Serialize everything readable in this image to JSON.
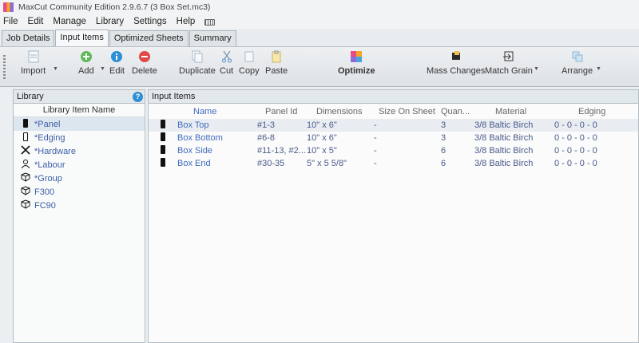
{
  "window": {
    "title": "MaxCut Community Edition 2.9.6.7 (3 Box Set.mc3)"
  },
  "menu": [
    "File",
    "Edit",
    "Manage",
    "Library",
    "Settings",
    "Help"
  ],
  "tabs": [
    {
      "label": "Job Details",
      "active": false
    },
    {
      "label": "Input Items",
      "active": true
    },
    {
      "label": "Optimized Sheets",
      "active": false
    },
    {
      "label": "Summary",
      "active": false
    }
  ],
  "toolbar": {
    "import": "Import",
    "add": "Add",
    "edit": "Edit",
    "delete": "Delete",
    "duplicate": "Duplicate",
    "cut": "Cut",
    "copy": "Copy",
    "paste": "Paste",
    "optimize": "Optimize",
    "mass_changes": "Mass Changes",
    "match_grain": "Match Grain",
    "arrange": "Arrange"
  },
  "library": {
    "title": "Library",
    "help": "?",
    "column": "Library Item Name",
    "items": [
      {
        "label": "*Panel",
        "icon": "panel-icon",
        "selected": true
      },
      {
        "label": "*Edging",
        "icon": "edging-icon",
        "selected": false
      },
      {
        "label": "*Hardware",
        "icon": "hardware-icon",
        "selected": false
      },
      {
        "label": "*Labour",
        "icon": "labour-icon",
        "selected": false
      },
      {
        "label": "*Group",
        "icon": "group-icon",
        "selected": false
      },
      {
        "label": "F300",
        "icon": "group-icon",
        "selected": false
      },
      {
        "label": "FC90",
        "icon": "group-icon",
        "selected": false
      }
    ]
  },
  "input_items": {
    "title": "Input Items",
    "columns": {
      "name": "Name",
      "panel_id": "Panel Id",
      "dimensions": "Dimensions",
      "size_on_sheet": "Size On Sheet",
      "quantity": "Quan...",
      "material": "Material",
      "edging": "Edging"
    },
    "rows": [
      {
        "name": "Box Top",
        "panel_id": "#1-3",
        "dimensions": "10\" x 6\"",
        "size_on_sheet": "-",
        "quantity": "3",
        "material": "3/8 Baltic Birch",
        "edging": "0 - 0 - 0 - 0"
      },
      {
        "name": "Box Bottom",
        "panel_id": "#6-8",
        "dimensions": "10\" x 6\"",
        "size_on_sheet": "-",
        "quantity": "3",
        "material": "3/8 Baltic Birch",
        "edging": "0 - 0 - 0 - 0"
      },
      {
        "name": "Box Side",
        "panel_id": "#11-13, #2...",
        "dimensions": "10\" x 5\"",
        "size_on_sheet": "-",
        "quantity": "6",
        "material": "3/8 Baltic Birch",
        "edging": "0 - 0 - 0 - 0"
      },
      {
        "name": "Box End",
        "panel_id": "#30-35",
        "dimensions": "5\" x 5 5/8\"",
        "size_on_sheet": "-",
        "quantity": "6",
        "material": "3/8 Baltic Birch",
        "edging": "0 - 0 - 0 - 0"
      }
    ]
  }
}
